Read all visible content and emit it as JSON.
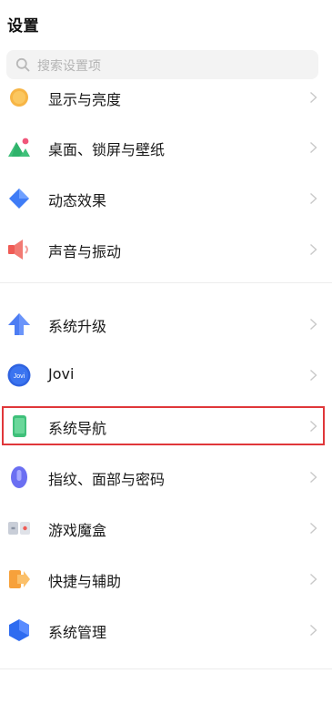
{
  "header": {
    "title": "设置"
  },
  "search": {
    "placeholder": "搜索设置项"
  },
  "group1": [
    {
      "label": "显示与亮度",
      "icon": "sun-icon"
    },
    {
      "label": "桌面、锁屏与壁纸",
      "icon": "wallpaper-icon"
    },
    {
      "label": "动态效果",
      "icon": "diamond-icon"
    },
    {
      "label": "声音与振动",
      "icon": "speaker-icon"
    }
  ],
  "group2": [
    {
      "label": "系统升级",
      "icon": "arrow-up-icon"
    },
    {
      "label": "Jovi",
      "icon": "jovi-icon",
      "icon_text": "Jovi"
    },
    {
      "label": "系统导航",
      "icon": "phone-icon"
    },
    {
      "label": "指纹、面部与密码",
      "icon": "fingerprint-icon"
    },
    {
      "label": "游戏魔盒",
      "icon": "game-box-icon"
    },
    {
      "label": "快捷与辅助",
      "icon": "shortcut-icon"
    },
    {
      "label": "系统管理",
      "icon": "hexagon-icon"
    }
  ],
  "colors": {
    "highlight": "#e0373a",
    "sun": "#f7b545",
    "blue": "#3f7cf6",
    "green": "#3fc07a",
    "red": "#ef5b55",
    "orange": "#f7a13b"
  }
}
